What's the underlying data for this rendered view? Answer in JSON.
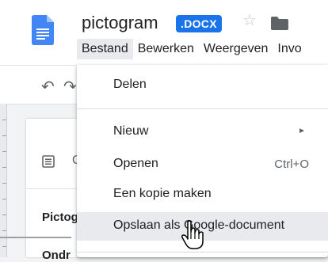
{
  "document": {
    "title": "pictogram",
    "format_badge": ".DOCX",
    "icons": {
      "doc": "docs-icon",
      "star": "star-icon",
      "folder": "folder-icon"
    }
  },
  "menubar": {
    "items": [
      "Bestand",
      "Bewerken",
      "Weergeven",
      "Invo"
    ],
    "active": "Bestand"
  },
  "toolbar": {
    "undo_icon": "undo-icon",
    "redo_icon": "redo-icon"
  },
  "file_menu": {
    "share": "Delen",
    "new": "Nieuw",
    "open": "Openen",
    "open_shortcut": "Ctrl+O",
    "make_copy": "Een kopie maken",
    "save_as_google": "Opslaan als Google-document",
    "submenu_arrow": "►"
  },
  "document_body": {
    "outline_letter": "O",
    "heading_1": "Pictog",
    "heading_2": "Ondr"
  },
  "colors": {
    "accent": "#1a73e8",
    "doc_icon": "#4285f4",
    "hover": "#e8eaed",
    "text": "#202124",
    "muted": "#5f6368"
  }
}
